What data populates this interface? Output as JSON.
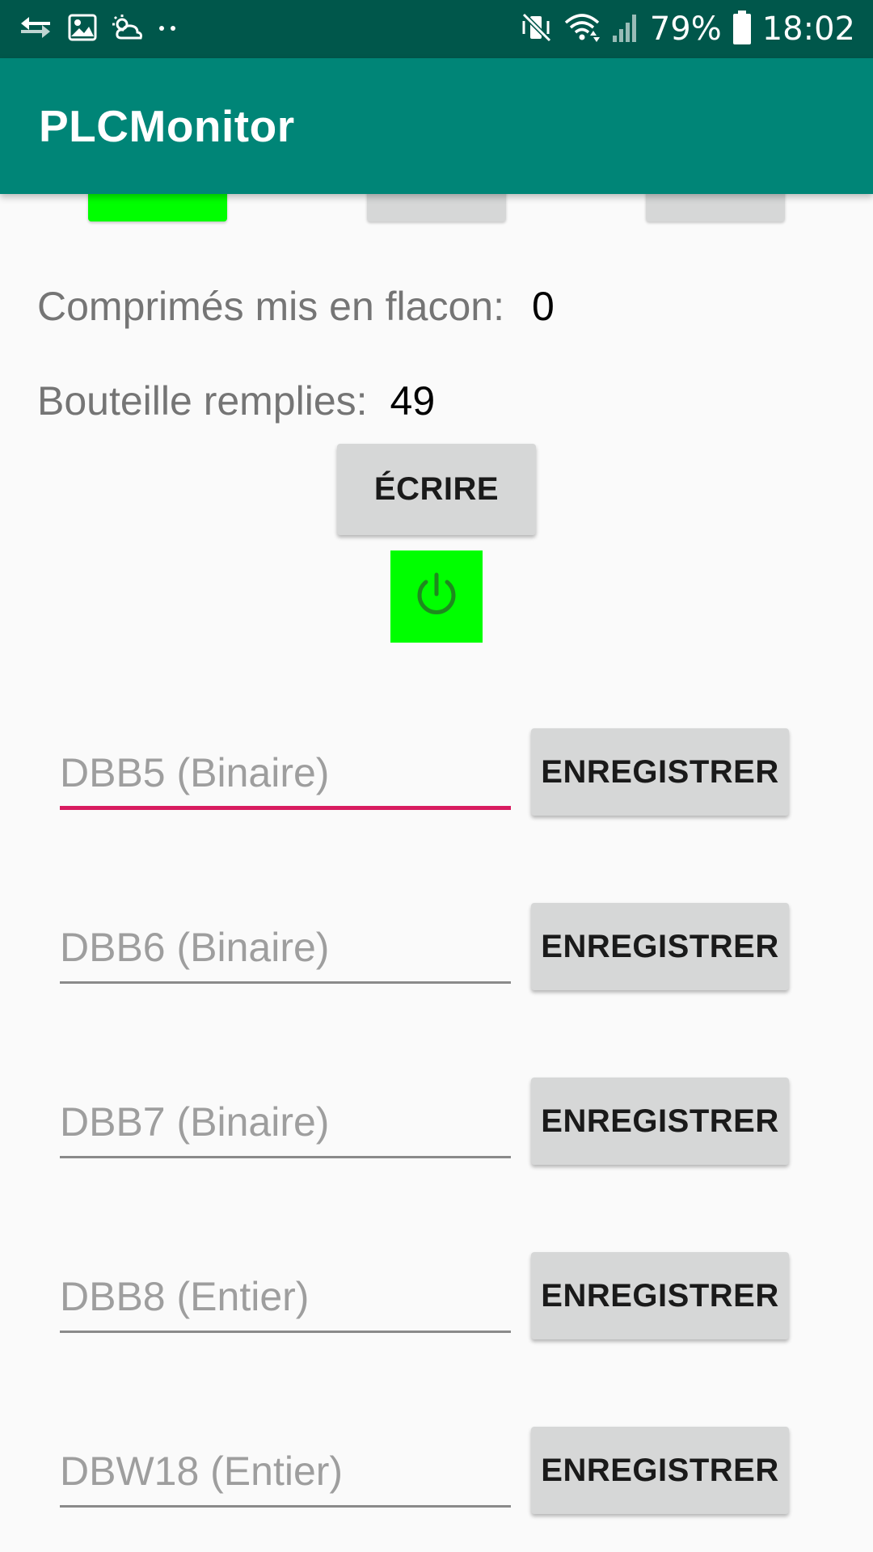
{
  "status_bar": {
    "battery": "79%",
    "time": "18:02",
    "icons": [
      "usb-transfer-icon",
      "image-icon",
      "weather-icon",
      "more-dots-icon",
      "mute-vibrate-icon",
      "wifi-icon",
      "signal-icon",
      "battery-icon"
    ]
  },
  "app": {
    "title": "PLCMonitor"
  },
  "indicators": {
    "colors": [
      "#00ff00",
      "#d6d7d7",
      "#d6d7d7"
    ]
  },
  "stats": {
    "tablets_label": "Comprimés mis en flacon:",
    "tablets_value": "0",
    "bottles_label": "Bouteille remplies:",
    "bottles_value": "49"
  },
  "write_button": {
    "label": "ÉCRIRE"
  },
  "power_button": {
    "icon": "power-icon",
    "color": "#00ff00"
  },
  "fields": [
    {
      "placeholder": "DBB5 (Binaire)",
      "button": "ENREGISTRER",
      "focused": true
    },
    {
      "placeholder": "DBB6 (Binaire)",
      "button": "ENREGISTRER",
      "focused": false
    },
    {
      "placeholder": "DBB7 (Binaire)",
      "button": "ENREGISTRER",
      "focused": false
    },
    {
      "placeholder": "DBB8 (Entier)",
      "button": "ENREGISTRER",
      "focused": false
    },
    {
      "placeholder": "DBW18 (Entier)",
      "button": "ENREGISTRER",
      "focused": false
    }
  ],
  "colors": {
    "status_bar": "#00574b",
    "app_bar": "#008577",
    "accent": "#d81b60",
    "active_green": "#00ff00",
    "button_gray": "#d6d7d7"
  }
}
